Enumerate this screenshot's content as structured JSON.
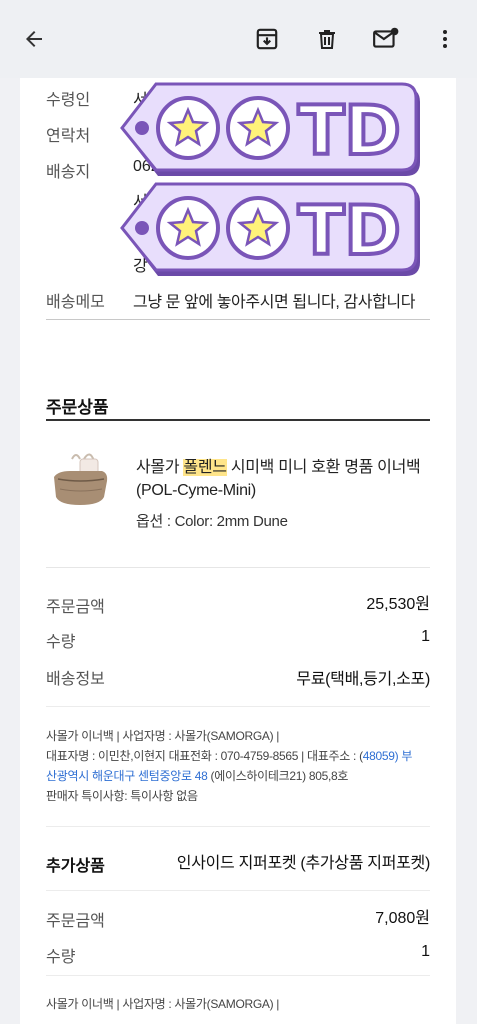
{
  "delivery": {
    "recipient_label": "수령인",
    "recipient_value": "서*",
    "contact_label": "연락처",
    "address_label": "배송지",
    "address_value": "062",
    "address_line2": "서울",
    "address_line3": "강",
    "memo_label": "배송메모",
    "memo_value": "그냥 문 앞에 놓아주시면 됩니다, 감사합니다"
  },
  "sticker": {
    "text": "TD"
  },
  "order": {
    "section_title": "주문상품",
    "product_name_prefix": "사몰가 ",
    "product_name_highlight": "폴렌느",
    "product_name_suffix": " 시미백 미니 호환 명품 이너백",
    "product_name_line2": "(POL-Cyme-Mini)",
    "product_option": "옵션 : Color: 2mm Dune",
    "amount_label": "주문금액",
    "amount_value": "25,530원",
    "qty_label": "수량",
    "qty_value": "1",
    "shipping_label": "배송정보",
    "shipping_value": "무료(택배,등기,소포)"
  },
  "seller": {
    "line1": "사몰가 이너백 | 사업자명 : 사몰가(SAMORGA) |",
    "line2_a": "대표자명 : 이민찬,이현지 대표전화 : 070-4759-8565 | 대표주소 : (",
    "line2_link": "48059) 부",
    "line3_link": "산광역시 해운대구 센텀중앙로 48",
    "line3_b": " (에이스하이테크21) 805,8호",
    "line4": "판매자 특이사항: 특이사항 없음"
  },
  "extra": {
    "section_title": "추가상품",
    "name": "인사이드 지퍼포켓 (추가상품 지퍼포켓)",
    "amount_label": "주문금액",
    "amount_value": "7,080원",
    "qty_label": "수량",
    "qty_value": "1",
    "seller_line1": "사몰가 이너백 | 사업자명 : 사몰가(SAMORGA) |"
  },
  "colors": {
    "sticker_fill": "#e9e0ff",
    "sticker_stroke": "#7a55b8",
    "star_fill": "#fff27a",
    "link": "#2f6fd3",
    "highlight": "#ffe58a"
  },
  "icons": [
    "back-arrow-icon",
    "archive-icon",
    "delete-icon",
    "mark-unread-icon",
    "more-vert-icon"
  ]
}
